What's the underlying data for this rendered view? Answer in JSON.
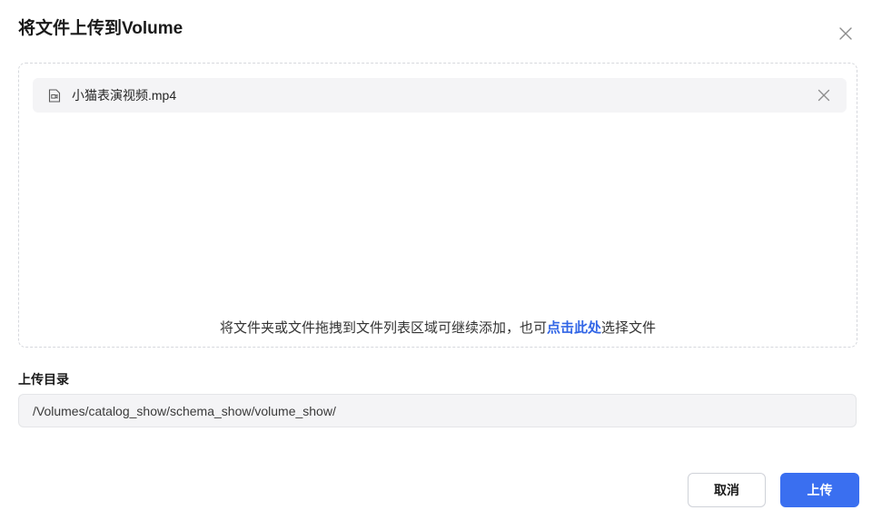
{
  "dialog": {
    "title": "将文件上传到Volume",
    "close_icon": "close-icon"
  },
  "dropzone": {
    "files": [
      {
        "name": "小猫表演视频.mp4",
        "icon": "video-file-icon",
        "remove_icon": "close-icon"
      }
    ],
    "hint_prefix": "将文件夹或文件拖拽到文件列表区域可继续添加，也可",
    "hint_link": "点击此处",
    "hint_suffix": "选择文件"
  },
  "upload_dir": {
    "label": "上传目录",
    "value": "/Volumes/catalog_show/schema_show/volume_show/"
  },
  "buttons": {
    "cancel": "取消",
    "upload": "上传"
  },
  "colors": {
    "accent": "#3a6ff0",
    "link": "#3266e6"
  }
}
